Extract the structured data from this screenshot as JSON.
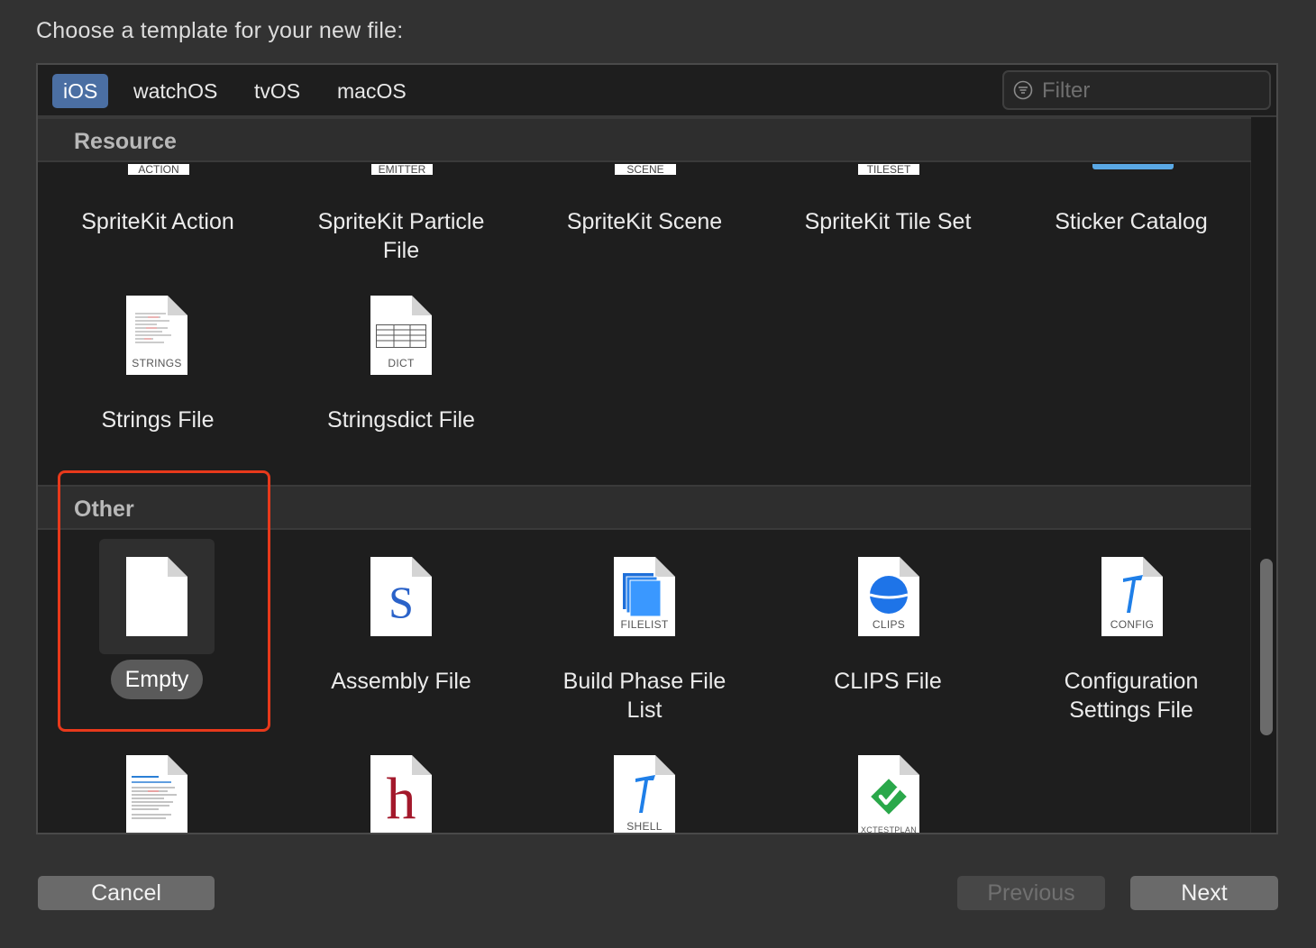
{
  "dialog": {
    "heading": "Choose a template for your new file:"
  },
  "platform_tabs": [
    {
      "label": "iOS",
      "active": true
    },
    {
      "label": "watchOS",
      "active": false
    },
    {
      "label": "tvOS",
      "active": false
    },
    {
      "label": "macOS",
      "active": false
    }
  ],
  "filter": {
    "placeholder": "Filter",
    "value": ""
  },
  "sections": {
    "resource": {
      "title": "Resource",
      "items": [
        {
          "label": "SpriteKit Action",
          "icon_caption": "ACTION"
        },
        {
          "label": "SpriteKit Particle File",
          "icon_caption": "EMITTER"
        },
        {
          "label": "SpriteKit Scene",
          "icon_caption": "SCENE"
        },
        {
          "label": "SpriteKit Tile Set",
          "icon_caption": "TILESET"
        },
        {
          "label": "Sticker Catalog",
          "icon_caption": ""
        },
        {
          "label": "Strings File",
          "icon_caption": "STRINGS"
        },
        {
          "label": "Stringsdict File",
          "icon_caption": "DICT"
        }
      ]
    },
    "other": {
      "title": "Other",
      "items": [
        {
          "label": "Empty",
          "icon_caption": "",
          "selected": true
        },
        {
          "label": "Assembly File",
          "icon_caption": "S"
        },
        {
          "label": "Build Phase File List",
          "icon_caption": "FILELIST"
        },
        {
          "label": "CLIPS File",
          "icon_caption": "CLIPS"
        },
        {
          "label": "Configuration Settings File",
          "icon_caption": "CONFIG"
        },
        {
          "label": "",
          "icon_caption": ""
        },
        {
          "label": "",
          "icon_caption": "h"
        },
        {
          "label": "",
          "icon_caption": "SHELL"
        },
        {
          "label": "",
          "icon_caption": "XCTESTPLAN"
        }
      ]
    }
  },
  "buttons": {
    "cancel": "Cancel",
    "previous": "Previous",
    "next": "Next"
  },
  "colors": {
    "selected_tab": "#4b6fa3",
    "highlight_border": "#e8391b",
    "background": "#1e1e1e"
  }
}
